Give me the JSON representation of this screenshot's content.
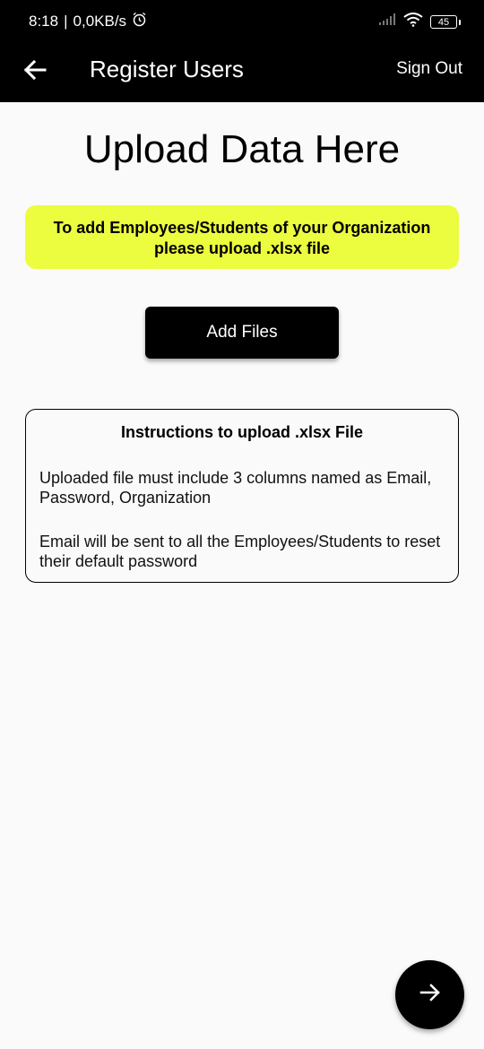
{
  "status_bar": {
    "time": "8:18",
    "separator": "|",
    "network_speed": "0,0KB/s",
    "battery": "45",
    "icons": [
      "alarm-icon",
      "signal-icon",
      "wifi-icon",
      "battery-icon"
    ]
  },
  "app_bar": {
    "title": "Register Users",
    "sign_out_label": "Sign Out",
    "back_icon": "back-arrow-icon"
  },
  "main": {
    "page_title": "Upload Data Here",
    "notice_line1": "To add Employees/Students of your Organization",
    "notice_line2": "please upload .xlsx file",
    "add_files_label": "Add Files"
  },
  "instructions": {
    "title": "Instructions to upload .xlsx File",
    "items": [
      "Uploaded file must include 3 columns named as Email, Password, Organization",
      "Email will be sent to all the Employees/Students to reset their default password"
    ]
  },
  "fab": {
    "icon": "forward-arrow-icon"
  },
  "colors": {
    "app_bar": "#000000",
    "background": "#fafafa",
    "notice_background": "#ecfc3f",
    "button": "#000000"
  }
}
